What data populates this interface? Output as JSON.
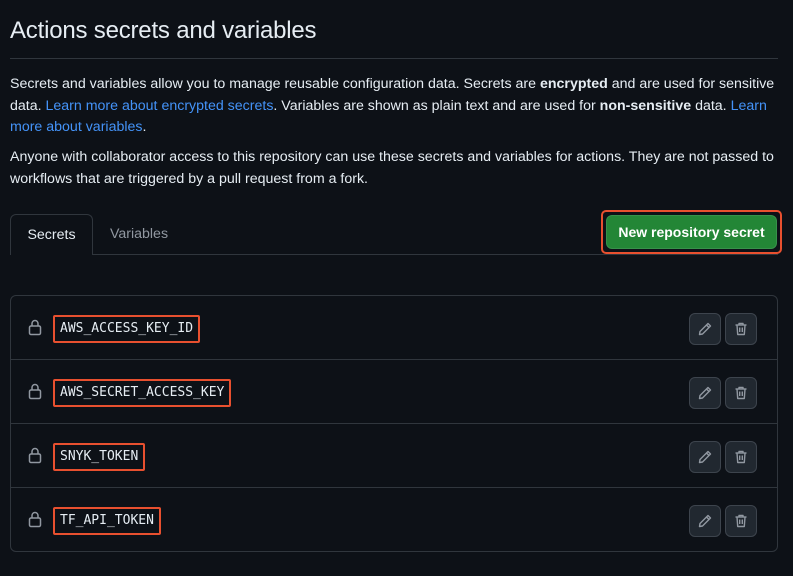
{
  "page": {
    "title": "Actions secrets and variables",
    "intro": {
      "t1": "Secrets and variables allow you to manage reusable configuration data. Secrets are ",
      "b1": "encrypted",
      "t2": " and are used for sensitive data. ",
      "link1": "Learn more about encrypted secrets",
      "t3": ". Variables are shown as plain text and are used for ",
      "b2": "non-sensitive",
      "t4": " data. ",
      "link2": "Learn more about variables",
      "t5": "."
    },
    "access_note": "Anyone with collaborator access to this repository can use these secrets and variables for actions. They are not passed to workflows that are triggered by a pull request from a fork."
  },
  "tabs": [
    {
      "label": "Secrets",
      "selected": true
    },
    {
      "label": "Variables",
      "selected": false
    }
  ],
  "new_secret_button": "New repository secret",
  "secrets": [
    {
      "name": "AWS_ACCESS_KEY_ID",
      "icon": "lock-icon"
    },
    {
      "name": "AWS_SECRET_ACCESS_KEY",
      "icon": "lock-icon"
    },
    {
      "name": "SNYK_TOKEN",
      "icon": "lock-icon"
    },
    {
      "name": "TF_API_TOKEN",
      "icon": "lock-icon"
    }
  ],
  "row_actions": {
    "edit_icon": "pencil-icon",
    "delete_icon": "trash-icon"
  },
  "colors": {
    "background": "#0d1117",
    "border": "#30363d",
    "link": "#4493f8",
    "primary_button": "#238636",
    "highlight": "#e8502f"
  }
}
